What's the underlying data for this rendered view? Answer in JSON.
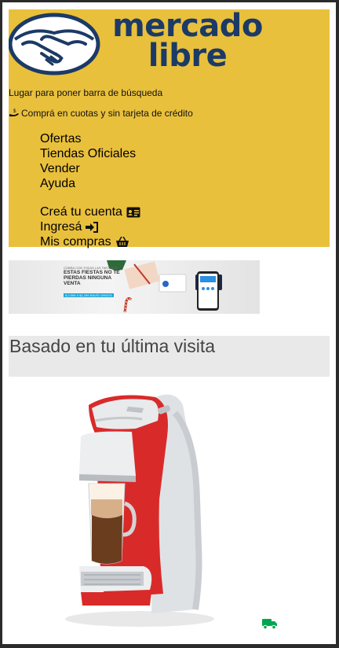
{
  "header": {
    "logo_alt": "mercado libre",
    "logo_line1": "mercado",
    "logo_line2": "libre",
    "search_placeholder": "Lugar para poner barra de búsqueda",
    "promo_text": "Comprá en cuotas y sin tarjeta de crédito",
    "nav": {
      "offers": "Ofertas",
      "official_stores": "Tiendas Oficiales",
      "sell": "Vender",
      "help": "Ayuda"
    },
    "account": {
      "create": "Creá tu cuenta",
      "login": "Ingresá",
      "purchases": "Mis compras"
    }
  },
  "banner": {
    "small_top": "COBRA CON TODAS LAS TARJETAS",
    "headline": "ESTAS FIESTAS NO TE PIERDAS NINGUNA VENTA",
    "tag": "$ 2.999 X $1.299 ENVÍO GRATIS"
  },
  "section": {
    "title": "Basado en tu última visita"
  },
  "product": {
    "image_name": "dolce-gusto-mini-me-coffee-maker"
  },
  "colors": {
    "brand_yellow": "#e9c03c",
    "brand_navy": "#1c3a66",
    "shipping_green": "#00a650"
  }
}
